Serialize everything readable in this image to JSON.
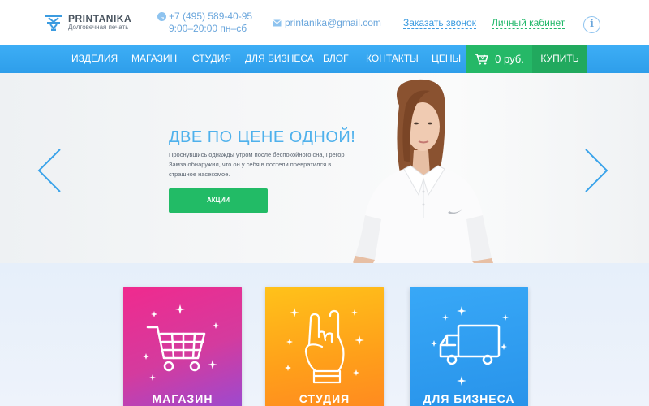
{
  "brand": {
    "name": "PRINTANIKA",
    "tagline": "Долговечная печать"
  },
  "contacts": {
    "phone": "+7 (495) 589-40-95",
    "hours": "9:00–20:00 пн–сб",
    "email": "printanika@gmail.com"
  },
  "header_links": {
    "callback": "Заказать звонок",
    "cabinet": "Личный кабинет"
  },
  "nav": {
    "items": [
      "Изделия",
      "Магазин",
      "Студия",
      "Для бизнеса",
      "Блог",
      "Контакты",
      "Цены"
    ],
    "cart_total": "0 руб.",
    "buy_label": "Купить"
  },
  "hero": {
    "title": "ДВЕ ПО ЦЕНЕ ОДНОЙ!",
    "text": "Проснувшись однажды утром после беспокойного сна, Грегор Замза обнаружил, что он у себя в постели превратился в страшное насекомое.",
    "button": "АКЦИИ"
  },
  "categories": [
    {
      "label": "МАГАЗИН",
      "icon": "shopping-cart-icon"
    },
    {
      "label": "СТУДИЯ",
      "icon": "rock-hand-icon"
    },
    {
      "label": "ДЛЯ БИЗНЕСА",
      "icon": "delivery-truck-icon"
    }
  ],
  "colors": {
    "nav_blue": "#2e9eea",
    "accent_green": "#22bb66",
    "title_blue": "#4fb1ec",
    "shop_pink": "#f02a8e",
    "studio_orange": "#ffb31a",
    "business_blue": "#38a8f7"
  }
}
